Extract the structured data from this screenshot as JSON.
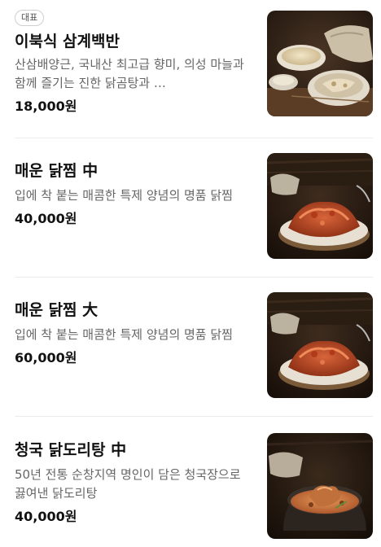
{
  "menu": {
    "items": [
      {
        "badge": "대표",
        "name": "이북식 삼계백반",
        "description": "산삼배양근, 국내산 최고급 향미, 의성 마늘과 함께 즐기는 진한 닭곰탕과 …",
        "price": "18,000원",
        "image": "samgye-baekban-photo"
      },
      {
        "badge": "",
        "name": "매운 닭찜 中",
        "description": "입에 착 붙는 매콤한 특제 양념의 명품 닭찜",
        "price": "40,000원",
        "image": "spicy-braised-chicken-photo"
      },
      {
        "badge": "",
        "name": "매운 닭찜 大",
        "description": "입에 착 붙는 매콤한 특제 양념의 명품 닭찜",
        "price": "60,000원",
        "image": "spicy-braised-chicken-photo"
      },
      {
        "badge": "",
        "name": "청국 닭도리탕 中",
        "description": "50년 전통 순창지역 명인이 담은 청국장으로 끓여낸 닭도리탕",
        "price": "40,000원",
        "image": "cheonggukjang-dakdoritang-photo"
      }
    ]
  },
  "colors": {
    "text_primary": "#111111",
    "text_secondary": "#666666",
    "divider": "#ececec",
    "badge_border": "#cfcfcf"
  }
}
